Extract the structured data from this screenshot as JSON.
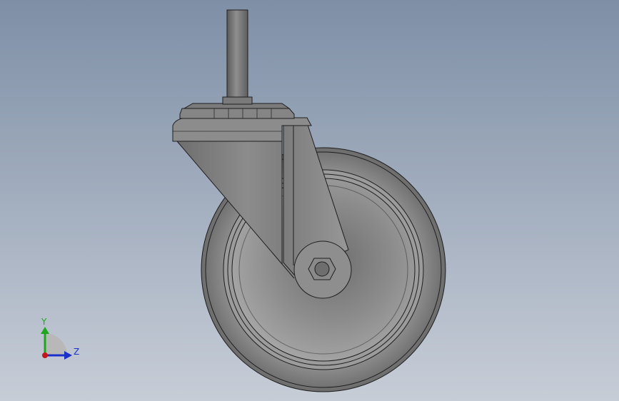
{
  "viewport": {
    "background_top": "#7E8FA6",
    "background_bottom": "#C7CDD7"
  },
  "model": {
    "part_color": "#8A8A8A",
    "edge_color": "#1E1E1E"
  },
  "triad": {
    "y_label": "Y",
    "z_label": "Z",
    "y_color": "#1FA51F",
    "z_color": "#1B2FC9",
    "x_color": "#C4161C"
  }
}
